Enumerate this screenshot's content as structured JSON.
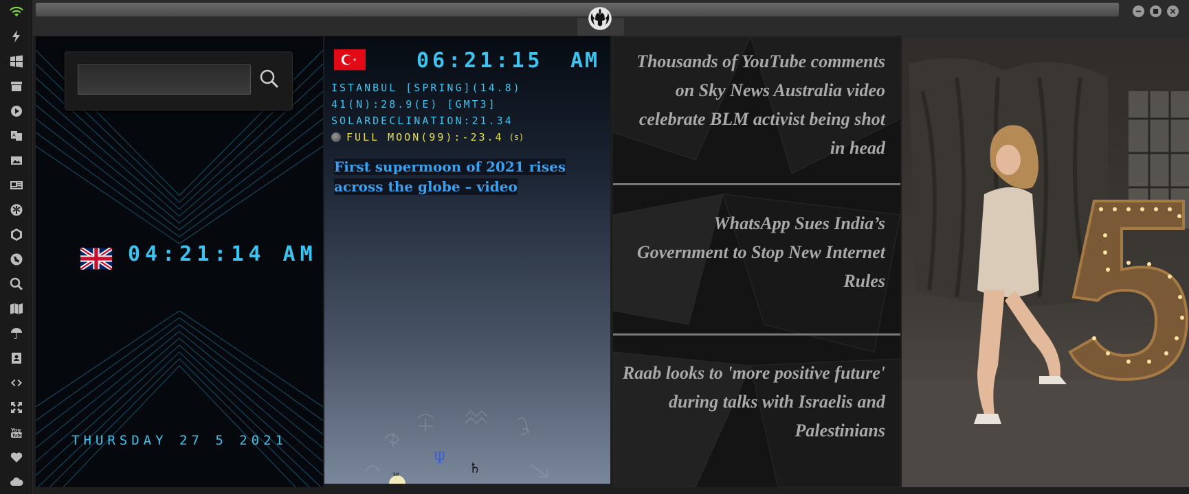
{
  "window": {
    "title_bar_icon": "rebel-alliance-logo",
    "buttons": [
      "minimize-icon",
      "maximize-icon",
      "close-icon"
    ]
  },
  "dock": {
    "icons": [
      "wifi-icon",
      "lightning-icon",
      "windows-icon",
      "archive-icon",
      "play-icon",
      "translate-icon",
      "image-icon",
      "news-icon",
      "asterisk-icon",
      "hexagon-icon",
      "globe-icon",
      "search-icon",
      "map-icon",
      "umbrella-icon",
      "contacts-icon",
      "code-icon",
      "expand-icon",
      "youtube-icon",
      "heart-icon",
      "cloud-icon"
    ]
  },
  "search": {
    "value": "",
    "placeholder": ""
  },
  "uk_clock": {
    "time": "04:21:14 AM",
    "flag": "uk-flag"
  },
  "date": "THURSDAY 27 5 2021",
  "istanbul": {
    "flag": "turkey-flag",
    "time": "06:21:15",
    "ampm": "AM",
    "line1": "ISTANBUL [SPRING](14.8)",
    "line2": "41(N):28.9(E) [GMT3]",
    "line3": "SOLARDECLINATION:21.34",
    "moon": "FULL MOON(99):-23.4",
    "moon_suffix": "(s)",
    "headline": "First supermoon of 2021 rises across the globe – video",
    "planet_symbols": [
      "Ψ",
      "♄",
      "♅"
    ]
  },
  "news": [
    "Thousands of YouTube comments on Sky News Australia video celebrate BLM activist being shot in head",
    "WhatsApp Sues India’s Government to Stop New Internet Rules",
    "Raab looks to 'more positive future' during talks with Israelis and Palestinians"
  ],
  "photo": {
    "caption_number": "5"
  },
  "colors": {
    "clock_cyan": "#3ec3f0",
    "moon_yellow": "#e9e04a",
    "headline_blue": "#3aa0f0",
    "news_gray": "#a9a9a9"
  }
}
